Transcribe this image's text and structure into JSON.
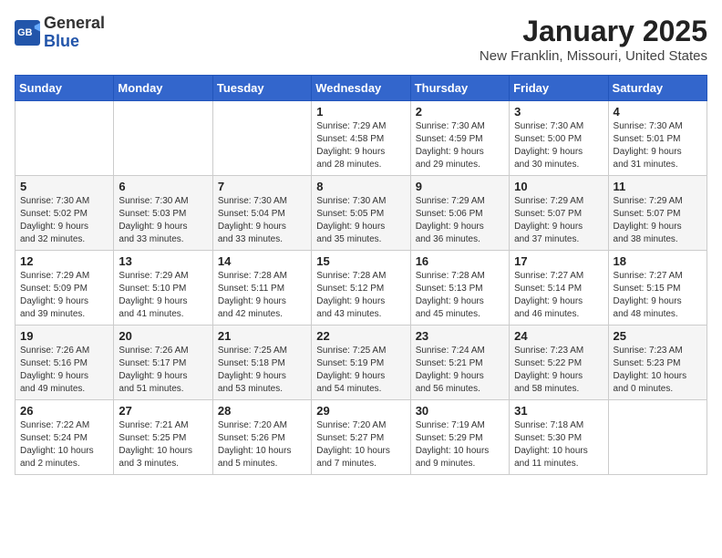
{
  "header": {
    "logo_general": "General",
    "logo_blue": "Blue",
    "title": "January 2025",
    "subtitle": "New Franklin, Missouri, United States"
  },
  "weekdays": [
    "Sunday",
    "Monday",
    "Tuesday",
    "Wednesday",
    "Thursday",
    "Friday",
    "Saturday"
  ],
  "weeks": [
    [
      {
        "day": "",
        "info": ""
      },
      {
        "day": "",
        "info": ""
      },
      {
        "day": "",
        "info": ""
      },
      {
        "day": "1",
        "info": "Sunrise: 7:29 AM\nSunset: 4:58 PM\nDaylight: 9 hours\nand 28 minutes."
      },
      {
        "day": "2",
        "info": "Sunrise: 7:30 AM\nSunset: 4:59 PM\nDaylight: 9 hours\nand 29 minutes."
      },
      {
        "day": "3",
        "info": "Sunrise: 7:30 AM\nSunset: 5:00 PM\nDaylight: 9 hours\nand 30 minutes."
      },
      {
        "day": "4",
        "info": "Sunrise: 7:30 AM\nSunset: 5:01 PM\nDaylight: 9 hours\nand 31 minutes."
      }
    ],
    [
      {
        "day": "5",
        "info": "Sunrise: 7:30 AM\nSunset: 5:02 PM\nDaylight: 9 hours\nand 32 minutes."
      },
      {
        "day": "6",
        "info": "Sunrise: 7:30 AM\nSunset: 5:03 PM\nDaylight: 9 hours\nand 33 minutes."
      },
      {
        "day": "7",
        "info": "Sunrise: 7:30 AM\nSunset: 5:04 PM\nDaylight: 9 hours\nand 33 minutes."
      },
      {
        "day": "8",
        "info": "Sunrise: 7:30 AM\nSunset: 5:05 PM\nDaylight: 9 hours\nand 35 minutes."
      },
      {
        "day": "9",
        "info": "Sunrise: 7:29 AM\nSunset: 5:06 PM\nDaylight: 9 hours\nand 36 minutes."
      },
      {
        "day": "10",
        "info": "Sunrise: 7:29 AM\nSunset: 5:07 PM\nDaylight: 9 hours\nand 37 minutes."
      },
      {
        "day": "11",
        "info": "Sunrise: 7:29 AM\nSunset: 5:07 PM\nDaylight: 9 hours\nand 38 minutes."
      }
    ],
    [
      {
        "day": "12",
        "info": "Sunrise: 7:29 AM\nSunset: 5:09 PM\nDaylight: 9 hours\nand 39 minutes."
      },
      {
        "day": "13",
        "info": "Sunrise: 7:29 AM\nSunset: 5:10 PM\nDaylight: 9 hours\nand 41 minutes."
      },
      {
        "day": "14",
        "info": "Sunrise: 7:28 AM\nSunset: 5:11 PM\nDaylight: 9 hours\nand 42 minutes."
      },
      {
        "day": "15",
        "info": "Sunrise: 7:28 AM\nSunset: 5:12 PM\nDaylight: 9 hours\nand 43 minutes."
      },
      {
        "day": "16",
        "info": "Sunrise: 7:28 AM\nSunset: 5:13 PM\nDaylight: 9 hours\nand 45 minutes."
      },
      {
        "day": "17",
        "info": "Sunrise: 7:27 AM\nSunset: 5:14 PM\nDaylight: 9 hours\nand 46 minutes."
      },
      {
        "day": "18",
        "info": "Sunrise: 7:27 AM\nSunset: 5:15 PM\nDaylight: 9 hours\nand 48 minutes."
      }
    ],
    [
      {
        "day": "19",
        "info": "Sunrise: 7:26 AM\nSunset: 5:16 PM\nDaylight: 9 hours\nand 49 minutes."
      },
      {
        "day": "20",
        "info": "Sunrise: 7:26 AM\nSunset: 5:17 PM\nDaylight: 9 hours\nand 51 minutes."
      },
      {
        "day": "21",
        "info": "Sunrise: 7:25 AM\nSunset: 5:18 PM\nDaylight: 9 hours\nand 53 minutes."
      },
      {
        "day": "22",
        "info": "Sunrise: 7:25 AM\nSunset: 5:19 PM\nDaylight: 9 hours\nand 54 minutes."
      },
      {
        "day": "23",
        "info": "Sunrise: 7:24 AM\nSunset: 5:21 PM\nDaylight: 9 hours\nand 56 minutes."
      },
      {
        "day": "24",
        "info": "Sunrise: 7:23 AM\nSunset: 5:22 PM\nDaylight: 9 hours\nand 58 minutes."
      },
      {
        "day": "25",
        "info": "Sunrise: 7:23 AM\nSunset: 5:23 PM\nDaylight: 10 hours\nand 0 minutes."
      }
    ],
    [
      {
        "day": "26",
        "info": "Sunrise: 7:22 AM\nSunset: 5:24 PM\nDaylight: 10 hours\nand 2 minutes."
      },
      {
        "day": "27",
        "info": "Sunrise: 7:21 AM\nSunset: 5:25 PM\nDaylight: 10 hours\nand 3 minutes."
      },
      {
        "day": "28",
        "info": "Sunrise: 7:20 AM\nSunset: 5:26 PM\nDaylight: 10 hours\nand 5 minutes."
      },
      {
        "day": "29",
        "info": "Sunrise: 7:20 AM\nSunset: 5:27 PM\nDaylight: 10 hours\nand 7 minutes."
      },
      {
        "day": "30",
        "info": "Sunrise: 7:19 AM\nSunset: 5:29 PM\nDaylight: 10 hours\nand 9 minutes."
      },
      {
        "day": "31",
        "info": "Sunrise: 7:18 AM\nSunset: 5:30 PM\nDaylight: 10 hours\nand 11 minutes."
      },
      {
        "day": "",
        "info": ""
      }
    ]
  ]
}
